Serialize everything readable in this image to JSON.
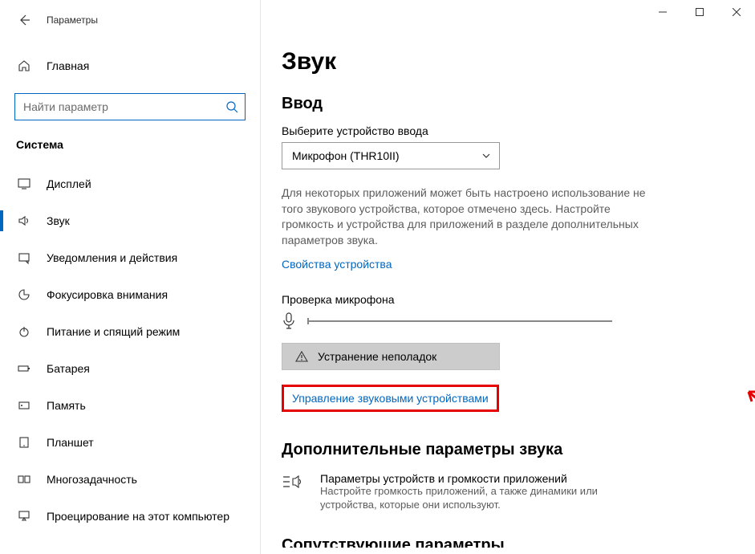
{
  "app_title": "Параметры",
  "home_label": "Главная",
  "search_placeholder": "Найти параметр",
  "category_title": "Система",
  "nav": [
    {
      "label": "Дисплей"
    },
    {
      "label": "Звук"
    },
    {
      "label": "Уведомления и действия"
    },
    {
      "label": "Фокусировка внимания"
    },
    {
      "label": "Питание и спящий режим"
    },
    {
      "label": "Батарея"
    },
    {
      "label": "Память"
    },
    {
      "label": "Планшет"
    },
    {
      "label": "Многозадачность"
    },
    {
      "label": "Проецирование на этот компьютер"
    }
  ],
  "page": {
    "title": "Звук",
    "input_heading": "Ввод",
    "device_label": "Выберите устройство ввода",
    "device_value": "Микрофон (THR10II)",
    "description": "Для некоторых приложений может быть настроено использование не того звукового устройства, которое отмечено здесь. Настройте громкость и устройства для приложений в разделе дополнительных параметров звука.",
    "device_props_link": "Свойства устройства",
    "mic_test_label": "Проверка микрофона",
    "troubleshoot_label": "Устранение неполадок",
    "manage_devices_link": "Управление звуковыми устройствами",
    "extra_heading": "Дополнительные параметры звука",
    "extra_item_title": "Параметры устройств и громкости приложений",
    "extra_item_desc": "Настройте громкость приложений, а также динамики или устройства, которые они используют.",
    "cutoff": "Сопутствующие параметры"
  }
}
